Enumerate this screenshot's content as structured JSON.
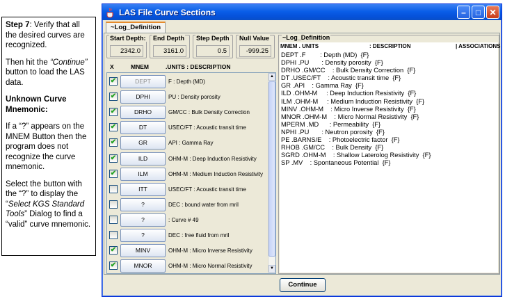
{
  "instructions": {
    "step_label": "Step 7",
    "step_text": ": Verify that all the desired curves are recognized.",
    "then_pre": "Then hit the ",
    "then_quote": "“Continue”",
    "then_post": " button to load the LAS data.",
    "unknown_heading": "Unknown Curve Mnemonic:",
    "if_text": "If a “?” appears on the MNEM Button then the program does not recognize the curve mnemonic.",
    "select_pre": "Select the button with the “?” to display the “",
    "select_italic": "Select KGS Standard Tools",
    "select_post": "” Dialog to find a “valid” curve mnemonic."
  },
  "window": {
    "title": "LAS File Curve Sections",
    "minimize": "–",
    "maximize": "□",
    "close": "✕"
  },
  "tab": {
    "label": "~Log_Definition"
  },
  "depth": {
    "start_label": "Start Depth:",
    "start_value": "2342.0",
    "end_label": "End Depth",
    "end_value": "3161.0",
    "step_label": "Step Depth",
    "step_value": "0.5",
    "null_label": "Null Value",
    "null_value": "-999.25"
  },
  "columns": {
    "x": "X",
    "mnem": "MNEM",
    "units_desc": ".UNITS  : DESCRIPTION"
  },
  "curves": [
    {
      "checked": true,
      "mnem": "DEPT",
      "dim": true,
      "desc": "F : Depth (MD)"
    },
    {
      "checked": true,
      "mnem": "DPHI",
      "dim": false,
      "desc": "PU : Density porosity"
    },
    {
      "checked": true,
      "mnem": "DRHO",
      "dim": false,
      "desc": "GM/CC : Bulk Density Correction"
    },
    {
      "checked": true,
      "mnem": "DT",
      "dim": false,
      "desc": "USEC/FT : Acoustic transit time"
    },
    {
      "checked": true,
      "mnem": "GR",
      "dim": false,
      "desc": "API : Gamma Ray"
    },
    {
      "checked": true,
      "mnem": "ILD",
      "dim": false,
      "desc": "OHM-M : Deep Induction Resistivity"
    },
    {
      "checked": true,
      "mnem": "ILM",
      "dim": false,
      "desc": "OHM-M : Medium Induction Resistivity"
    },
    {
      "checked": false,
      "mnem": "ITT",
      "dim": false,
      "desc": "USEC/FT : Acoustic transit time"
    },
    {
      "checked": false,
      "mnem": "?",
      "dim": false,
      "desc": "DEC : bound water from mril"
    },
    {
      "checked": false,
      "mnem": "?",
      "dim": false,
      "desc": " : Curve #  49"
    },
    {
      "checked": false,
      "mnem": "?",
      "dim": false,
      "desc": "DEC : free fluid from mril"
    },
    {
      "checked": true,
      "mnem": "MINV",
      "dim": false,
      "desc": "OHM-M : Micro Inverse Resistivity"
    },
    {
      "checked": true,
      "mnem": "MNOR",
      "dim": false,
      "desc": "OHM-M : Micro Normal Resistivity"
    }
  ],
  "definition": {
    "label": "~Log_Definition",
    "head_mnem": "MNEM . UNITS",
    "head_desc": ": DESCRIPTION",
    "head_assoc": "| ASSOCIATIONS",
    "lines": [
      "DEPT .F        : Depth (MD)  {F}",
      "DPHI .PU       : Density porosity  {F}",
      "DRHO .GM/CC    : Bulk Density Correction  {F}",
      "DT .USEC/FT    : Acoustic transit time  {F}",
      "GR .API    : Gamma Ray  {F}",
      "ILD .OHM-M     : Deep Induction Resistivity  {F}",
      "ILM .OHM-M     : Medium Induction Resistivity  {F}",
      "MINV .OHM-M    : Micro Inverse Resistivity  {F}",
      "MNOR .OHM-M    : Micro Normal Resistivity  {F}",
      "MPERM .MD      : Permeability  {F}",
      "NPHI .PU       : Neutron porosity  {F}",
      "PE .BARNS/E    : Photoelectric factor  {F}",
      "RHOB .GM/CC    : Bulk Density  {F}",
      "SGRD .OHM-M    : Shallow Laterolog Resistivity  {F}",
      "SP .MV    : Spontaneous Potential  {F}"
    ]
  },
  "continue_label": "Continue"
}
